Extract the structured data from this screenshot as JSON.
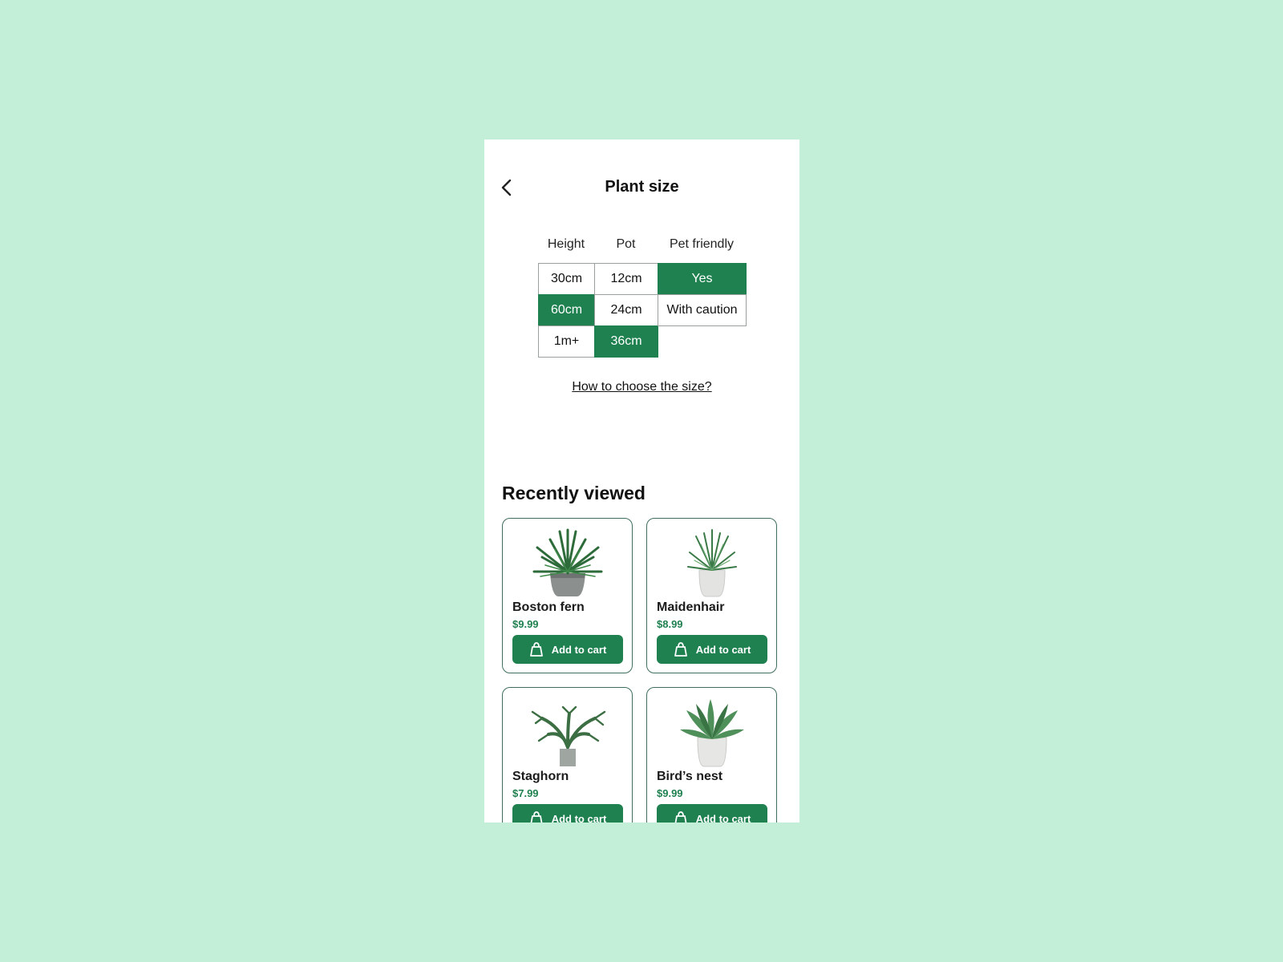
{
  "header": {
    "title": "Plant size",
    "back_icon": "chevron-left-icon"
  },
  "size_table": {
    "columns": [
      "Height",
      "Pot",
      "Pet friendly"
    ],
    "height_options": [
      {
        "label": "30cm",
        "selected": false
      },
      {
        "label": "60cm",
        "selected": true
      },
      {
        "label": "1m+",
        "selected": false
      }
    ],
    "pot_options": [
      {
        "label": "12cm",
        "selected": false
      },
      {
        "label": "24cm",
        "selected": false
      },
      {
        "label": "36cm",
        "selected": true
      }
    ],
    "pet_options": [
      {
        "label": "Yes",
        "selected": true
      },
      {
        "label": "With caution",
        "selected": false
      }
    ],
    "link_text": "How to choose the size?"
  },
  "recently_viewed": {
    "title": "Recently viewed",
    "items": [
      {
        "name": "Boston fern",
        "price": "$9.99",
        "button": "Add to cart"
      },
      {
        "name": "Maidenhair",
        "price": "$8.99",
        "button": "Add to cart"
      },
      {
        "name": "Staghorn",
        "price": "$7.99",
        "button": "Add to cart"
      },
      {
        "name": "Bird’s nest",
        "price": "$9.99",
        "button": "Add to cart"
      }
    ]
  },
  "colors": {
    "background": "#c3efd8",
    "accent": "#1f8150",
    "card_border": "#3f6f5c"
  }
}
